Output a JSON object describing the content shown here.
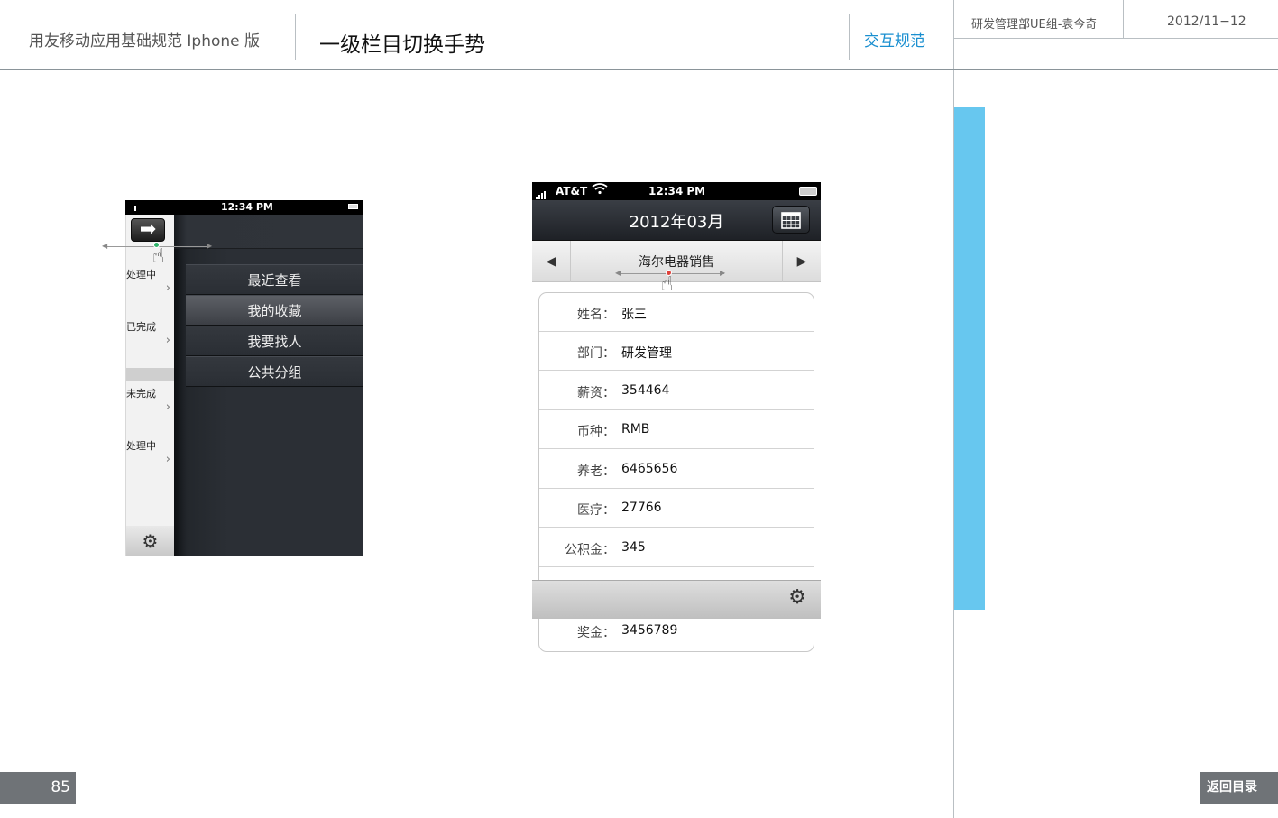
{
  "header": {
    "subtitle": "用友移动应用基础规范   Iphone 版",
    "title": "一级栏目切换手势",
    "category": "交互规范",
    "author": "研发管理部UE组-袁今奇",
    "date": "2012/11−12"
  },
  "footer": {
    "page_number": "85",
    "back_label": "返回目录"
  },
  "phone_menu": {
    "status_time": "12:34 PM",
    "menu_items": [
      {
        "label": "最近查看",
        "selected": false
      },
      {
        "label": "我的收藏",
        "selected": true
      },
      {
        "label": "我要找人",
        "selected": false
      },
      {
        "label": "公共分组",
        "selected": false
      }
    ],
    "list_rows": [
      "处理中",
      "已完成",
      "未完成",
      "处理中"
    ]
  },
  "phone_detail": {
    "carrier": "AT&T",
    "status_time": "12:34 PM",
    "nav_title": "2012年03月",
    "segment_title": "海尔电器销售",
    "fields": [
      {
        "key": "姓名：",
        "value": "张三"
      },
      {
        "key": "部门：",
        "value": "研发管理"
      },
      {
        "key": "薪资：",
        "value": "354464"
      },
      {
        "key": "币种：",
        "value": "RMB"
      },
      {
        "key": "养老：",
        "value": "6465656"
      },
      {
        "key": "医疗：",
        "value": "27766"
      },
      {
        "key": "公积金：",
        "value": "345"
      }
    ],
    "bonus": {
      "key": "奖金：",
      "value": "3456789"
    }
  },
  "colors": {
    "accent": "#1a8fd0",
    "side_bar": "#67c7ef",
    "footer_box": "#6f7377"
  }
}
